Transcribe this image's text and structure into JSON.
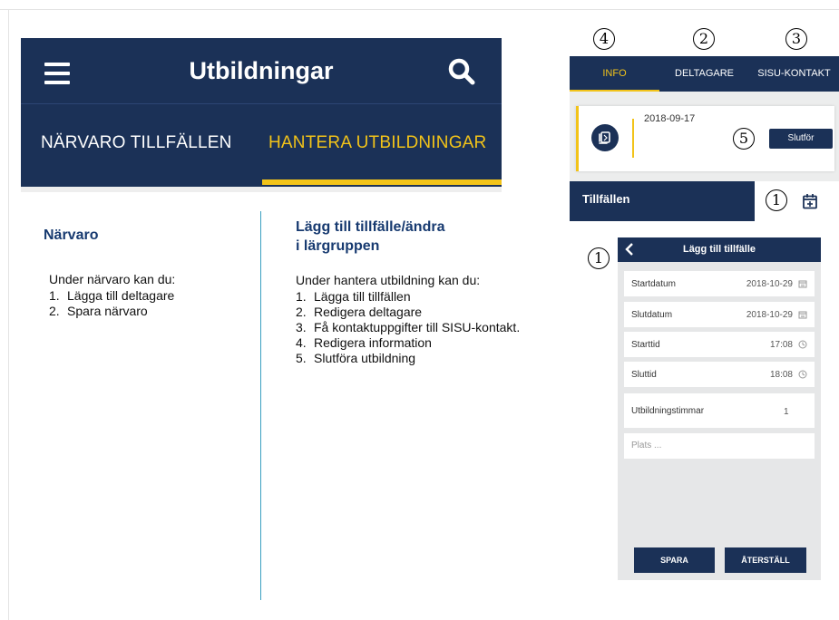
{
  "app_bar": {
    "title": "Utbildningar",
    "menu_icon": "hamburger-menu-icon",
    "search_icon": "search-icon",
    "tabs": [
      {
        "label": "NÄRVARO TILLFÄLLEN",
        "active": false
      },
      {
        "label": "HANTERA UTBILDNINGAR",
        "active": true
      }
    ]
  },
  "left_column": {
    "heading": "Närvaro",
    "intro": "Under närvaro kan du:",
    "items": [
      {
        "num": "1.",
        "text": "Lägga till deltagare"
      },
      {
        "num": "2.",
        "text": "Spara närvaro"
      }
    ]
  },
  "right_column": {
    "heading_line1": "Lägg till tillfälle/ändra",
    "heading_line2": "i lärgruppen",
    "intro": "Under hantera utbildning kan du:",
    "items": [
      {
        "num": "1.",
        "text": "Lägga till tillfällen"
      },
      {
        "num": "2.",
        "text": "Redigera deltagare"
      },
      {
        "num": "3.",
        "text": "Få kontaktuppgifter till SISU-kontakt."
      },
      {
        "num": "4.",
        "text": "Redigera information"
      },
      {
        "num": "5.",
        "text": "Slutföra utbildning"
      }
    ]
  },
  "markers": {
    "info": "4",
    "deltagare": "2",
    "sisu": "3",
    "slutfor": "5",
    "calendar": "1",
    "dialog": "1"
  },
  "detail_tabs": [
    {
      "label": "INFO",
      "active": true
    },
    {
      "label": "DELTAGARE",
      "active": false
    },
    {
      "label": "SISU-KONTAKT",
      "active": false
    }
  ],
  "info_card": {
    "date": "2018-09-17",
    "copy_icon": "copy-icon",
    "finish_button": "Slutför"
  },
  "tillfallen": {
    "label": "Tillfällen",
    "add_icon": "calendar-add-icon"
  },
  "dialog": {
    "title": "Lägg till tillfälle",
    "back_icon": "chevron-left-icon",
    "fields": {
      "startdatum": {
        "label": "Startdatum",
        "value": "2018-10-29"
      },
      "slutdatum": {
        "label": "Slutdatum",
        "value": "2018-10-29"
      },
      "starttid": {
        "label": "Starttid",
        "value": "17:08"
      },
      "sluttid": {
        "label": "Sluttid",
        "value": "18:08"
      },
      "timmar": {
        "label": "Utbildningstimmar",
        "value": "1"
      },
      "plats": {
        "placeholder": "Plats ..."
      }
    },
    "save_label": "SPARA",
    "reset_label": "ÅTERSTÄLL"
  },
  "colors": {
    "navy": "#1b3157",
    "accent_yellow": "#f2c319",
    "heading_blue": "#173a70",
    "divider_teal": "#3aa0c0"
  }
}
